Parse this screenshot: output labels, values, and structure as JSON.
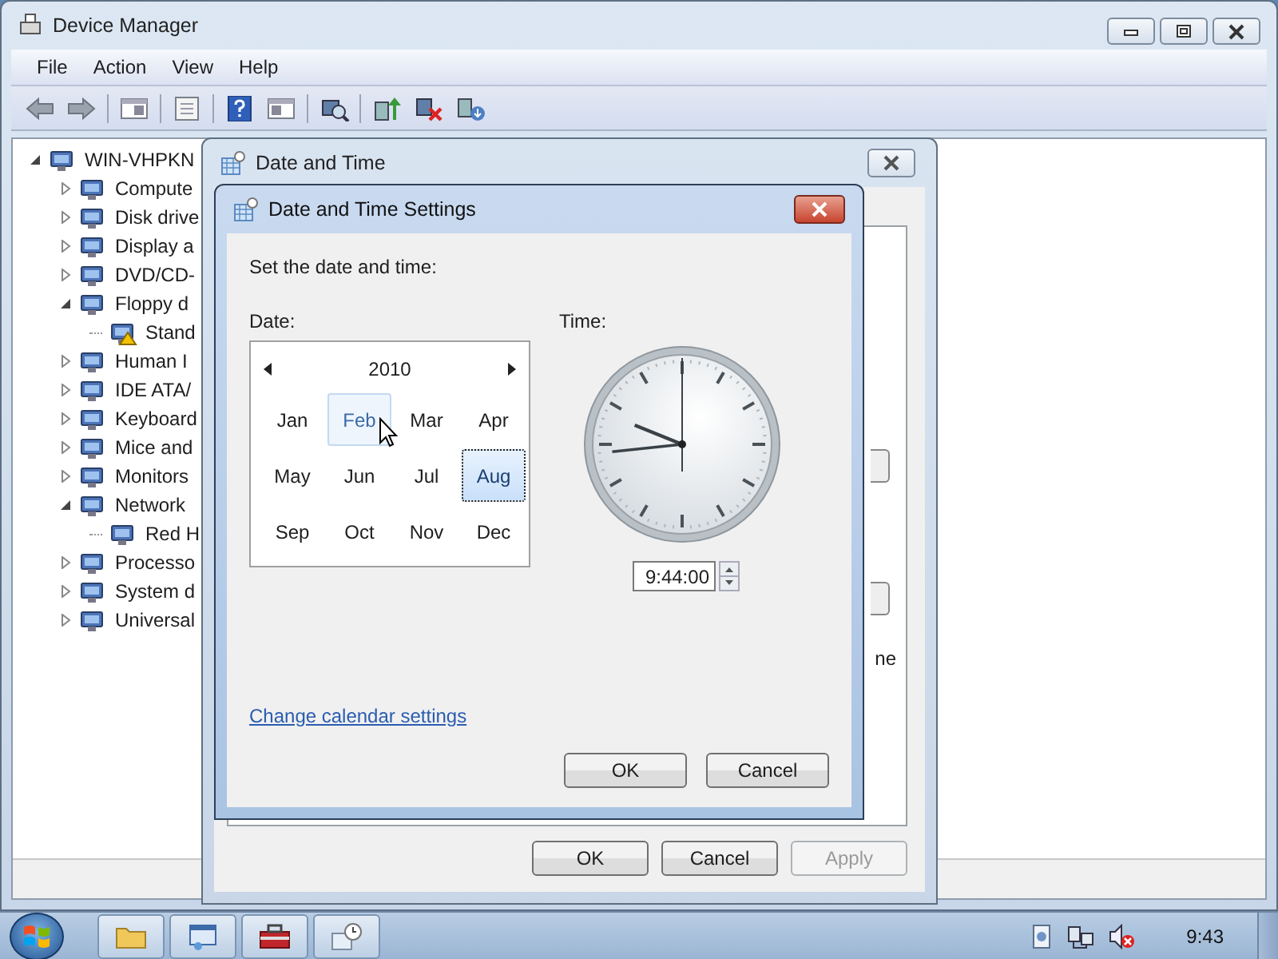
{
  "device_manager": {
    "title": "Device Manager",
    "menu": [
      {
        "label": "File"
      },
      {
        "label": "Action"
      },
      {
        "label": "View"
      },
      {
        "label": "Help"
      }
    ],
    "tree": [
      {
        "label": "WIN-VHPKN",
        "expanded": true,
        "children": [
          {
            "label": "Compute",
            "expanded": false
          },
          {
            "label": "Disk drive",
            "expanded": false
          },
          {
            "label": "Display a",
            "expanded": false
          },
          {
            "label": "DVD/CD-",
            "expanded": false
          },
          {
            "label": "Floppy d",
            "expanded": true,
            "children": [
              {
                "label": "Stand",
                "warning": true
              }
            ]
          },
          {
            "label": "Human I",
            "expanded": false
          },
          {
            "label": "IDE ATA/",
            "expanded": false
          },
          {
            "label": "Keyboard",
            "expanded": false
          },
          {
            "label": "Mice and",
            "expanded": false
          },
          {
            "label": "Monitors",
            "expanded": false
          },
          {
            "label": "Network",
            "expanded": true,
            "children": [
              {
                "label": "Red H",
                "warning": false
              }
            ]
          },
          {
            "label": "Processo",
            "expanded": false
          },
          {
            "label": "System d",
            "expanded": false
          },
          {
            "label": "Universal",
            "expanded": false
          }
        ]
      }
    ]
  },
  "date_time_dialog": {
    "title": "Date and Time",
    "panel_fragment": "ne",
    "buttons": [
      {
        "label": "OK",
        "disabled": false
      },
      {
        "label": "Cancel",
        "disabled": false
      },
      {
        "label": "Apply",
        "disabled": true
      }
    ]
  },
  "settings_dialog": {
    "title": "Date and Time Settings",
    "prompt": "Set the date and time:",
    "date_label": "Date:",
    "time_label": "Time:",
    "calendar": {
      "year": "2010",
      "months": [
        {
          "label": "Jan",
          "selected": false,
          "hovered": false
        },
        {
          "label": "Feb",
          "selected": false,
          "hovered": true
        },
        {
          "label": "Mar",
          "selected": false,
          "hovered": false
        },
        {
          "label": "Apr",
          "selected": false,
          "hovered": false
        },
        {
          "label": "May",
          "selected": false,
          "hovered": false
        },
        {
          "label": "Jun",
          "selected": false,
          "hovered": false
        },
        {
          "label": "Jul",
          "selected": false,
          "hovered": false
        },
        {
          "label": "Aug",
          "selected": true,
          "hovered": false
        },
        {
          "label": "Sep",
          "selected": false,
          "hovered": false
        },
        {
          "label": "Oct",
          "selected": false,
          "hovered": false
        },
        {
          "label": "Nov",
          "selected": false,
          "hovered": false
        },
        {
          "label": "Dec",
          "selected": false,
          "hovered": false
        }
      ]
    },
    "time_value": "9:44:00",
    "link": "Change calendar settings",
    "buttons": [
      {
        "label": "OK"
      },
      {
        "label": "Cancel"
      }
    ]
  },
  "taskbar": {
    "clock": "9:43"
  }
}
